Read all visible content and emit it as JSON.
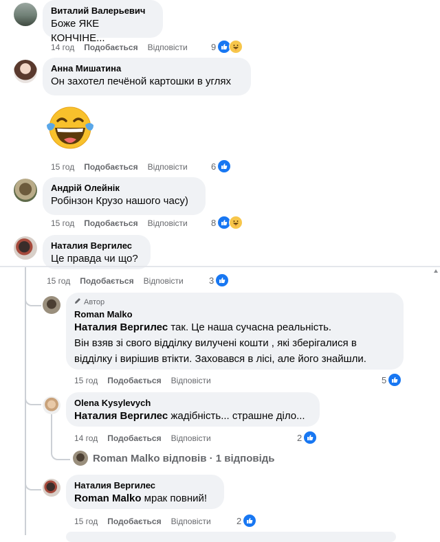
{
  "comments": [
    {
      "author": "Виталий Валерьевич",
      "text": "Боже ЯКЕ КОНЧІНЕ...",
      "time": "14 год",
      "like": "Подобається",
      "reply": "Відповісти",
      "count": "9"
    },
    {
      "author": "Анна Мишатина",
      "text": "Он захотел печёной картошки в углях",
      "time": "15 год",
      "like": "Подобається",
      "reply": "Відповісти",
      "count": "6"
    },
    {
      "author": "Андрій Олейнік",
      "text": "Робінзон Крузо нашого часу)",
      "time": "15 год",
      "like": "Подобається",
      "reply": "Відповісти",
      "count": "8"
    },
    {
      "author": "Наталия Вергилес",
      "text": "Це правда чи що?",
      "time": "15 год",
      "like": "Подобається",
      "reply": "Відповісти",
      "count": "3"
    }
  ],
  "replies": [
    {
      "badge": "Автор",
      "author": "Roman Malko",
      "mention": "Наталия Вергилес",
      "text": " так. Це наша сучасна реальність.",
      "line2": "Він взяв зі свого відділку вилучені кошти , які зберігалися в",
      "line3": "відділку і вирішив втікти. Заховався в лісі, але його знайшли.",
      "time": "15 год",
      "like": "Подобається",
      "reply": "Відповісти",
      "count": "5"
    },
    {
      "author": "Olena Kysylevych",
      "mention": "Наталия Вергилес",
      "text": " жадібність... страшне діло...",
      "time": "14 год",
      "like": "Подобається",
      "reply": "Відповісти",
      "count": "2"
    },
    {
      "author": "Наталия Вергилес",
      "mention": "Roman Malko",
      "text": " мрак повний!",
      "time": "15 год",
      "like": "Подобається",
      "reply": "Відповісти",
      "count": "2"
    }
  ],
  "nested_reply": {
    "text": "Roman Malko відповів · 1 відповідь"
  },
  "icons": {
    "like": "like-icon",
    "haha": "haha-icon",
    "emoji": "laughing-tears-emoji",
    "pencil": "pencil-icon"
  },
  "colors": {
    "like_blue": "#1877f2",
    "meta_gray": "#65676b",
    "bubble_bg": "#f0f2f5"
  }
}
